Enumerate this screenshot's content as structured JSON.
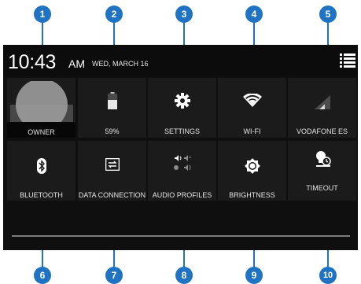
{
  "status_bar": {
    "time": "10:43",
    "ampm": "AM",
    "date": "WED, MARCH 16"
  },
  "tiles": [
    {
      "label": "OWNER"
    },
    {
      "label": "59%"
    },
    {
      "label": "SETTINGS"
    },
    {
      "label": "WI-FI"
    },
    {
      "label": "VODAFONE ES"
    },
    {
      "label": "BLUETOOTH"
    },
    {
      "label": "DATA CONNECTION"
    },
    {
      "label": "AUDIO PROFILES"
    },
    {
      "label": "BRIGHTNESS"
    },
    {
      "label": "TIMEOUT"
    }
  ],
  "callouts": [
    "1",
    "2",
    "3",
    "4",
    "5",
    "6",
    "7",
    "8",
    "9",
    "10"
  ],
  "colors": {
    "callout": "#1f73c2",
    "panel_bg": "#0f0f0f",
    "tile_bg": "#1b1b1b",
    "text": "#e4e4e4"
  },
  "status": {
    "battery_level": 0.59
  }
}
